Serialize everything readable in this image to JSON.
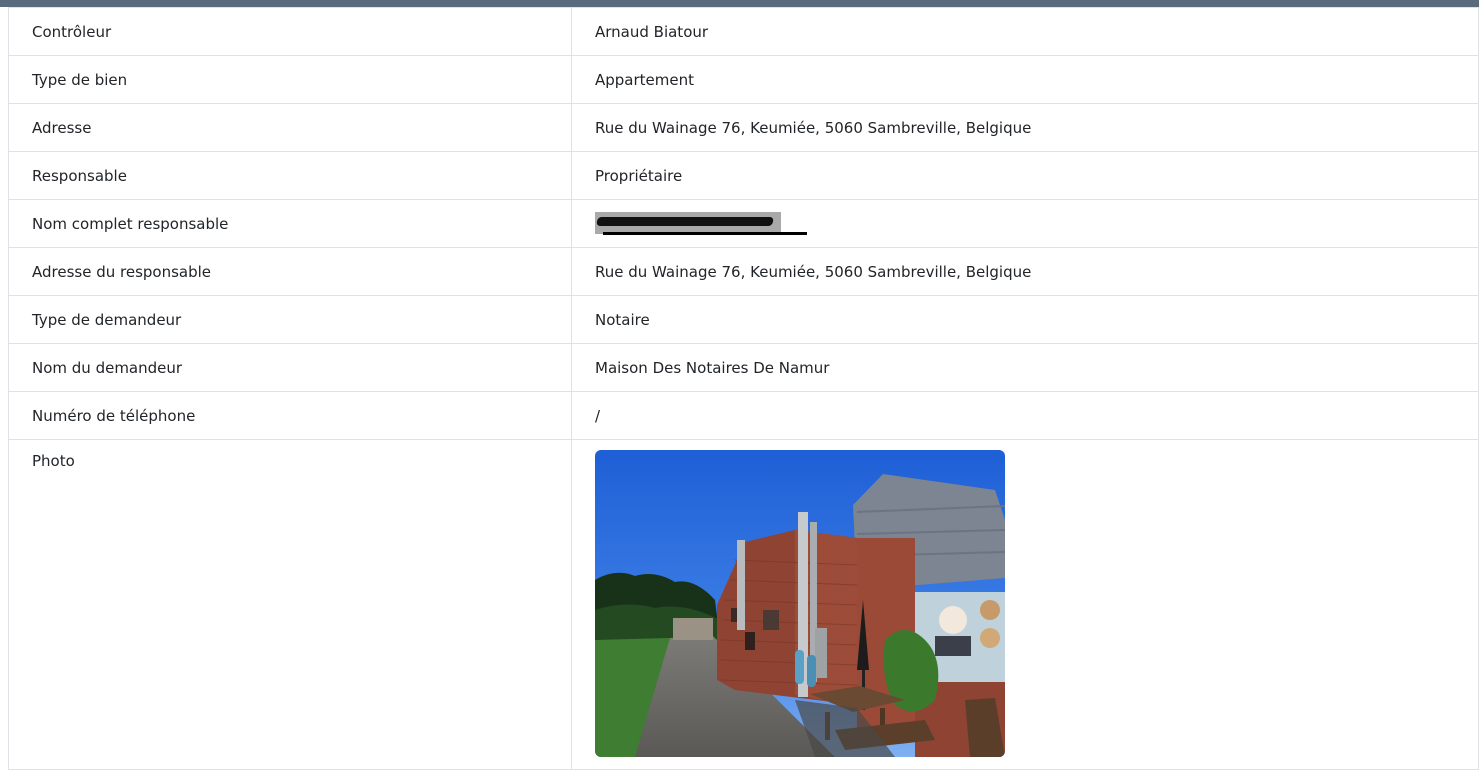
{
  "rows": [
    {
      "label": "Contrôleur",
      "value": "Arnaud Biatour"
    },
    {
      "label": "Type de bien",
      "value": "Appartement"
    },
    {
      "label": "Adresse",
      "value": "Rue du Wainage 76, Keumiée, 5060 Sambreville, Belgique"
    },
    {
      "label": "Responsable",
      "value": "Propriétaire"
    },
    {
      "label": "Nom complet responsable",
      "value": ""
    },
    {
      "label": "Adresse du responsable",
      "value": "Rue du Wainage 76, Keumiée, 5060 Sambreville, Belgique"
    },
    {
      "label": "Type de demandeur",
      "value": "Notaire"
    },
    {
      "label": "Nom du demandeur",
      "value": "Maison Des Notaires De Namur"
    },
    {
      "label": "Numéro de téléphone",
      "value": "/"
    },
    {
      "label": "Photo",
      "value": ""
    }
  ]
}
